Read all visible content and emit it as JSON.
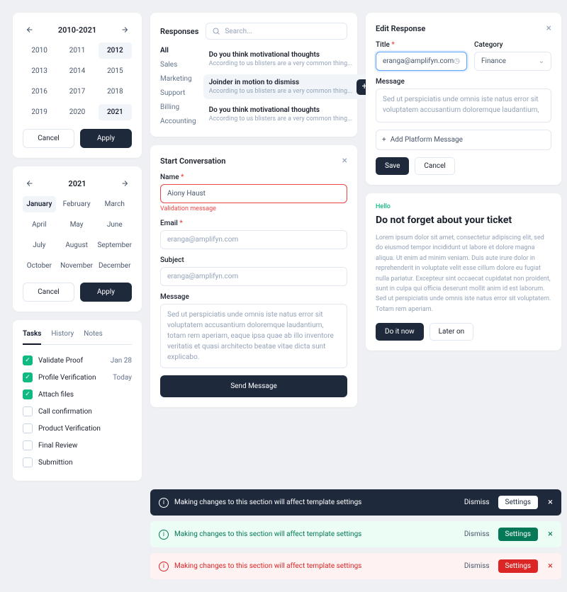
{
  "yearPicker": {
    "title": "2010-2021",
    "cells": [
      "2010",
      "2011",
      "2012",
      "2013",
      "2014",
      "2015",
      "2016",
      "2017",
      "2018",
      "2019",
      "2020",
      "2021"
    ],
    "selected": [
      "2012",
      "2021"
    ],
    "cancel": "Cancel",
    "apply": "Apply"
  },
  "monthPicker": {
    "title": "2021",
    "cells": [
      "January",
      "February",
      "March",
      "April",
      "May",
      "June",
      "July",
      "August",
      "September",
      "October",
      "November",
      "December"
    ],
    "selected": [
      "January"
    ],
    "cancel": "Cancel",
    "apply": "Apply"
  },
  "tabs": {
    "items": [
      "Tasks",
      "History",
      "Notes"
    ],
    "active": "Tasks"
  },
  "tasks": [
    {
      "label": "Validate Proof",
      "done": true,
      "date": "Jan 28"
    },
    {
      "label": "Profile Verification",
      "done": true,
      "date": "Today"
    },
    {
      "label": "Attach files",
      "done": true,
      "date": ""
    },
    {
      "label": "Call confirmation",
      "done": false,
      "date": ""
    },
    {
      "label": "Product Verification",
      "done": false,
      "date": ""
    },
    {
      "label": "Final Review",
      "done": false,
      "date": ""
    },
    {
      "label": "Submittion",
      "done": false,
      "date": ""
    }
  ],
  "responses": {
    "title": "Responses",
    "searchPlaceholder": "Search...",
    "cats": [
      "All",
      "Sales",
      "Marketing",
      "Support",
      "Billing",
      "Accounting"
    ],
    "activeCat": "All",
    "items": [
      {
        "title": "Do you think motivational thoughts",
        "sub": "According to us blisters are a very common thing..."
      },
      {
        "title": "Joinder in motion to dismiss",
        "sub": "According to us blisters are a very common thing...",
        "sel": true
      },
      {
        "title": "Do you think motivational thoughts",
        "sub": "According to us blisters are a very common thing..."
      }
    ]
  },
  "convo": {
    "title": "Start Conversation",
    "nameLabel": "Name ",
    "nameVal": "Aiony Haust",
    "nameErr": "Validation message",
    "emailLabel": "Email ",
    "emailPh": "eranga@amplifyn.com",
    "subjectLabel": "Subject",
    "subjectPh": "eranga@amplifyn.com",
    "msgLabel": "Message",
    "msgPh": "Sed ut perspiciatis unde omnis iste natus error sit voluptatem accusantium doloremque laudantium, totam rem aperiam, eaque ipsa quae ab illo inventore veritatis et quasi architecto beatae vitae dicta sunt explicabo.",
    "send": "Send Message"
  },
  "edit": {
    "title": "Edit Response",
    "titleLabel": "Title ",
    "titleVal": "eranga@amplifyn.com",
    "catLabel": "Category",
    "catVal": "Finance",
    "msgLabel": "Message",
    "msgPh": "Sed ut perspiciatis unde omnis iste natus error sit voluptatem accusantium doloremque laudantium,",
    "add": "Add Platform Message",
    "save": "Save",
    "cancel": "Cancel"
  },
  "ticket": {
    "hello": "Hello",
    "title": "Do not forget about your ticket",
    "body": "Lorem ipsum dolor sit amet, consectetur adipiscing elit, sed do eiusmod tempor incididunt ut labore et dolore magna aliqua. Ut enim ad minim veniam. Duis aute irure dolor in reprehenderit in voluptate velit esse cillum dolore eu fugiat nulla pariatur. Excepteur sint occaecat cupidatat non proident, sunt in culpa qui officia deserunt mollit anim id est laborum. Sed ut perspiciatis unde omnis iste natus error sit voluptatem. Totam rem aperiam.",
    "doit": "Do it now",
    "later": "Later on"
  },
  "alerts": {
    "msg": "Making changes to this section will affect template settings",
    "dismiss": "Dismiss",
    "settings": "Settings"
  }
}
